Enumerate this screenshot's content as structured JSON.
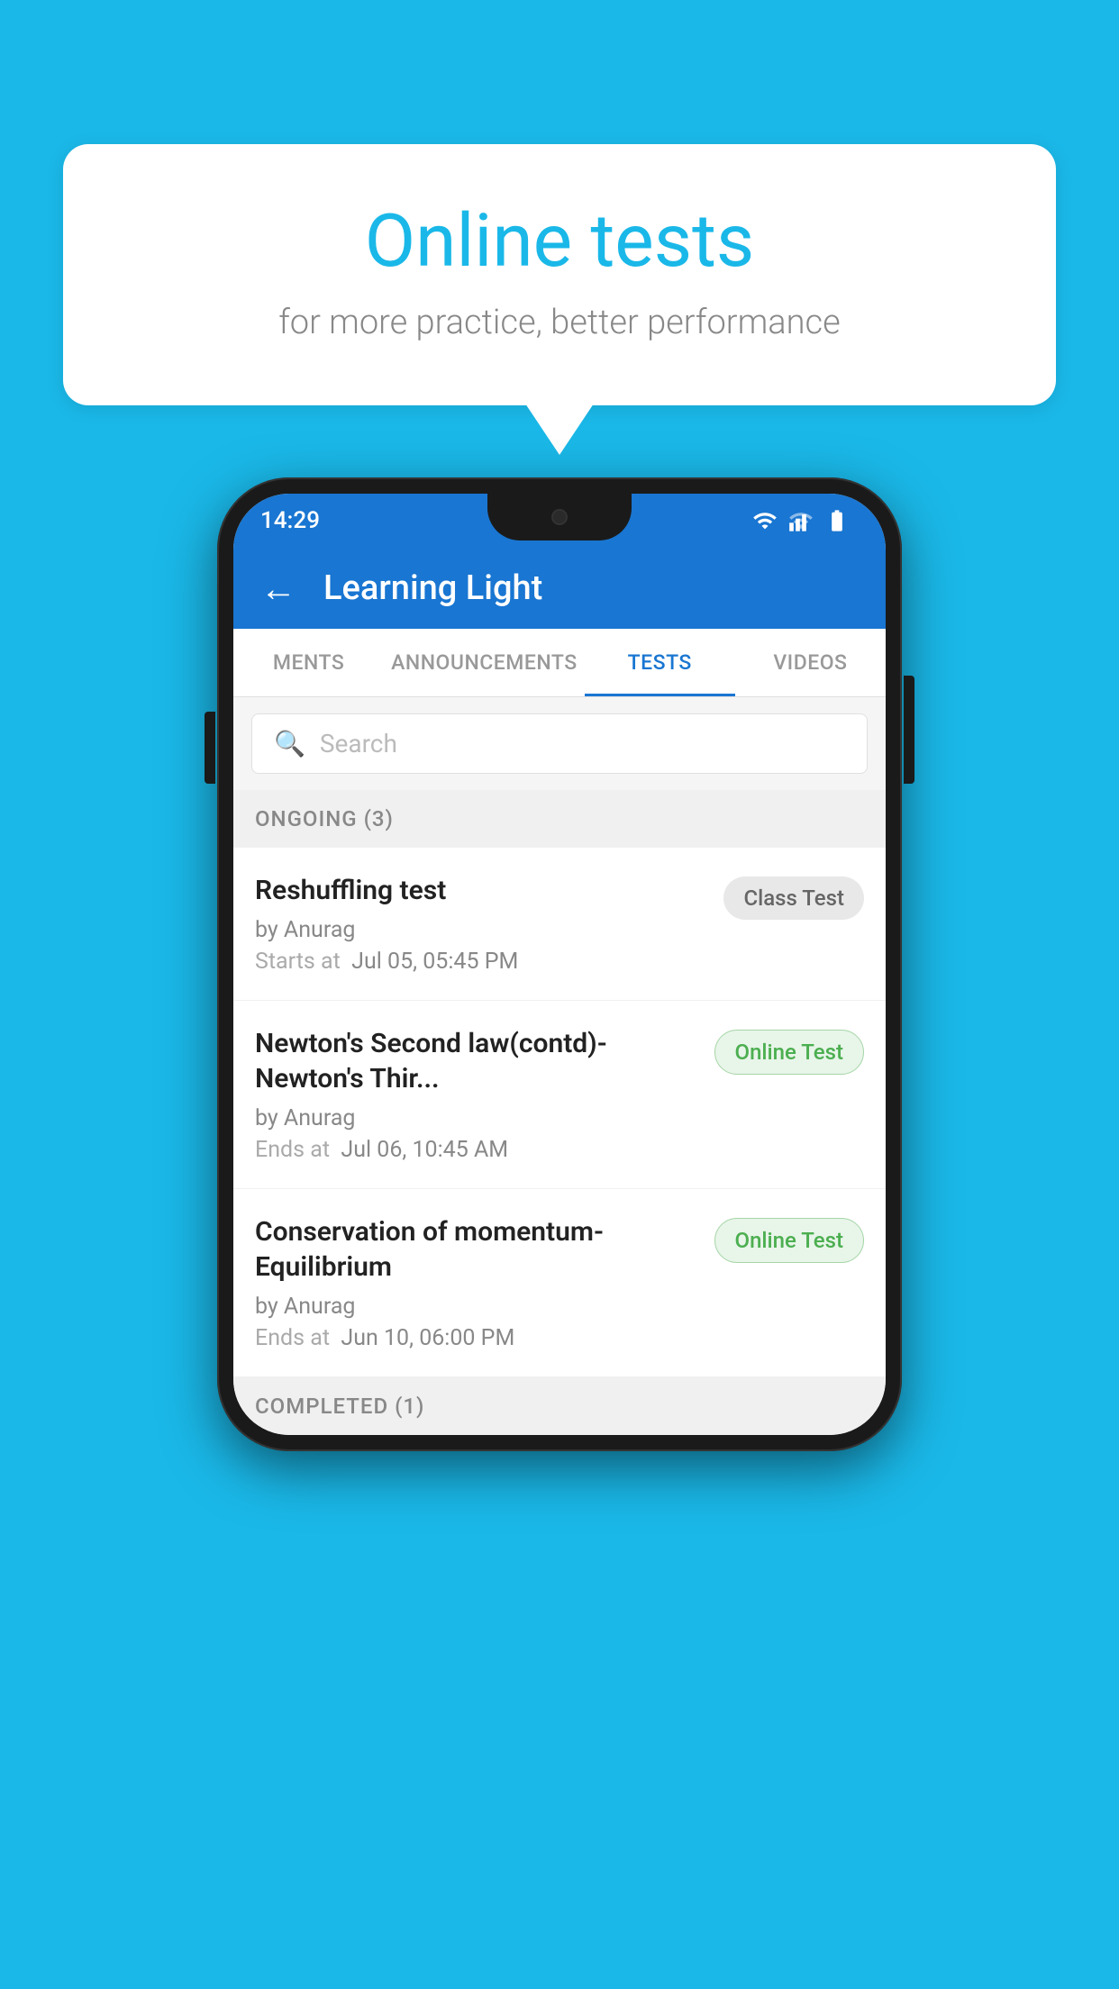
{
  "background_color": "#1ab8e8",
  "speech_bubble": {
    "title": "Online tests",
    "subtitle": "for more practice, better performance"
  },
  "phone": {
    "status_bar": {
      "time": "14:29"
    },
    "app_bar": {
      "title": "Learning Light",
      "back_label": "←"
    },
    "tabs": [
      {
        "label": "MENTS",
        "active": false
      },
      {
        "label": "ANNOUNCEMENTS",
        "active": false
      },
      {
        "label": "TESTS",
        "active": true
      },
      {
        "label": "VIDEOS",
        "active": false
      }
    ],
    "search": {
      "placeholder": "Search"
    },
    "ongoing_section": {
      "header": "ONGOING (3)",
      "tests": [
        {
          "title": "Reshuffling test",
          "author": "by Anurag",
          "date_label": "Starts at",
          "date": "Jul 05, 05:45 PM",
          "badge": "Class Test",
          "badge_type": "class"
        },
        {
          "title": "Newton's Second law(contd)-Newton's Thir...",
          "author": "by Anurag",
          "date_label": "Ends at",
          "date": "Jul 06, 10:45 AM",
          "badge": "Online Test",
          "badge_type": "online"
        },
        {
          "title": "Conservation of momentum-Equilibrium",
          "author": "by Anurag",
          "date_label": "Ends at",
          "date": "Jun 10, 06:00 PM",
          "badge": "Online Test",
          "badge_type": "online"
        }
      ]
    },
    "completed_section": {
      "header": "COMPLETED (1)"
    }
  }
}
